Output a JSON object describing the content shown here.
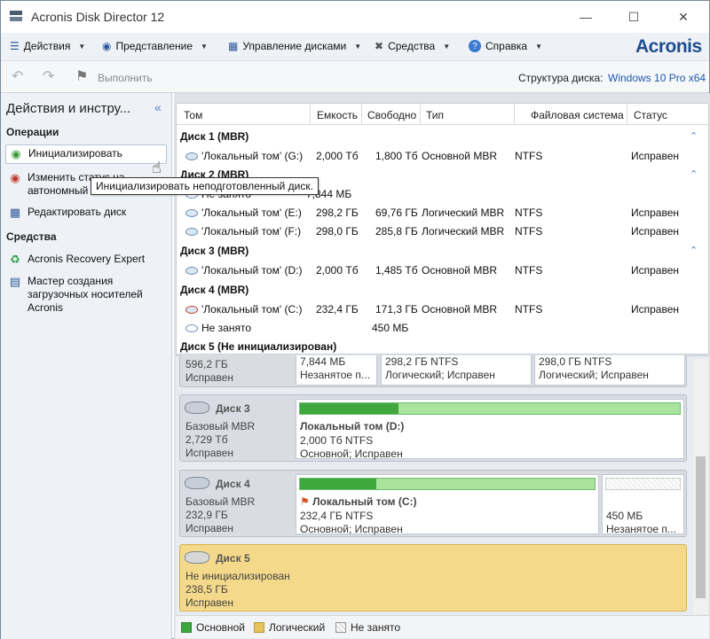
{
  "window": {
    "title": "Acronis Disk Director 12"
  },
  "menu": {
    "items": [
      "Действия",
      "Представление",
      "Управление дисками",
      "Средства",
      "Справка"
    ],
    "logo": "Acronis"
  },
  "toolbar": {
    "apply_label": "Выполнить",
    "structure_label": "Структура диска:",
    "structure_value": "Windows 10 Pro x64"
  },
  "sidebar": {
    "title": "Действия и инстру...",
    "ops_heading": "Операции",
    "op_init": "Инициализировать",
    "op_change_1": "Изменить статус на",
    "op_change_2": "автономный",
    "op_edit": "Редактировать диск",
    "tools_heading": "Средства",
    "tool_recovery": "Acronis Recovery Expert",
    "tool_media_1": "Мастер создания",
    "tool_media_2": "загрузочных носителей",
    "tool_media_3": "Acronis"
  },
  "tooltip": "Инициализировать неподготовленный диск.",
  "grid": {
    "headers": [
      "Том",
      "Емкость",
      "Свободно",
      "Тип",
      "Файловая система",
      "Статус"
    ],
    "disk1": "Диск 1 (MBR)",
    "disk2": "Диск 2 (MBR)",
    "disk3": "Диск 3 (MBR)",
    "disk4": "Диск 4 (MBR)",
    "disk5": "Диск 5 (Не инициализирован)",
    "rows": [
      {
        "name": "'Локальный том' (G:)",
        "cap": "2,000 Тб",
        "free": "1,800 Тб",
        "type": "Основной MBR",
        "fs": "NTFS",
        "status": "Исправен"
      },
      {
        "name": "Не занято",
        "cap": "",
        "free": "7,844 МБ",
        "type": "",
        "fs": "",
        "status": ""
      },
      {
        "name": "'Локальный том' (E:)",
        "cap": "298,2 ГБ",
        "free": "69,76 ГБ",
        "type": "Логический MBR",
        "fs": "NTFS",
        "status": "Исправен"
      },
      {
        "name": "'Локальный том' (F:)",
        "cap": "298,0 ГБ",
        "free": "285,8 ГБ",
        "type": "Логический MBR",
        "fs": "NTFS",
        "status": "Исправен"
      },
      {
        "name": "'Локальный том' (D:)",
        "cap": "2,000 Тб",
        "free": "1,485 Тб",
        "type": "Основной MBR",
        "fs": "NTFS",
        "status": "Исправен"
      },
      {
        "name": "'Локальный том' (C:)",
        "cap": "232,4 ГБ",
        "free": "171,3 ГБ",
        "type": "Основной MBR",
        "fs": "NTFS",
        "status": "Исправен"
      },
      {
        "name": "Не занято",
        "cap": "450 МБ",
        "free": "",
        "type": "",
        "fs": "",
        "status": ""
      }
    ]
  },
  "maps": {
    "d2": {
      "size": "596,2 ГБ",
      "status": "Исправен",
      "p1a": "7,844 МБ",
      "p1b": "Незанятое п...",
      "p2a": "298,2 ГБ NTFS",
      "p2b": "Логический; Исправен",
      "p3a": "298,0 ГБ NTFS",
      "p3b": "Логический; Исправен"
    },
    "d3": {
      "name": "Диск 3",
      "kind": "Базовый MBR",
      "size": "2,729 Тб",
      "status": "Исправен",
      "vol": "Локальный том (D:)",
      "vsize": "2,000 Тб NTFS",
      "vstat": "Основной; Исправен",
      "used": 0.26
    },
    "d4": {
      "name": "Диск 4",
      "kind": "Базовый MBR",
      "size": "232,9 ГБ",
      "status": "Исправен",
      "vol": "Локальный том (C:)",
      "vsize": "232,4 ГБ NTFS",
      "vstat": "Основной; Исправен",
      "used": 0.26,
      "free_size": "450 МБ",
      "free_label": "Незанятое п..."
    },
    "d5": {
      "name": "Диск 5",
      "kind": "Не инициализирован",
      "size": "238,5 ГБ",
      "status": "Исправен"
    }
  },
  "legend": [
    "Основной",
    "Логический",
    "Не занято"
  ],
  "colors": {
    "primary": "#3ea83e",
    "logical": "#e6c45a",
    "selected": "#f4d98a",
    "accent": "#1e4d91"
  }
}
